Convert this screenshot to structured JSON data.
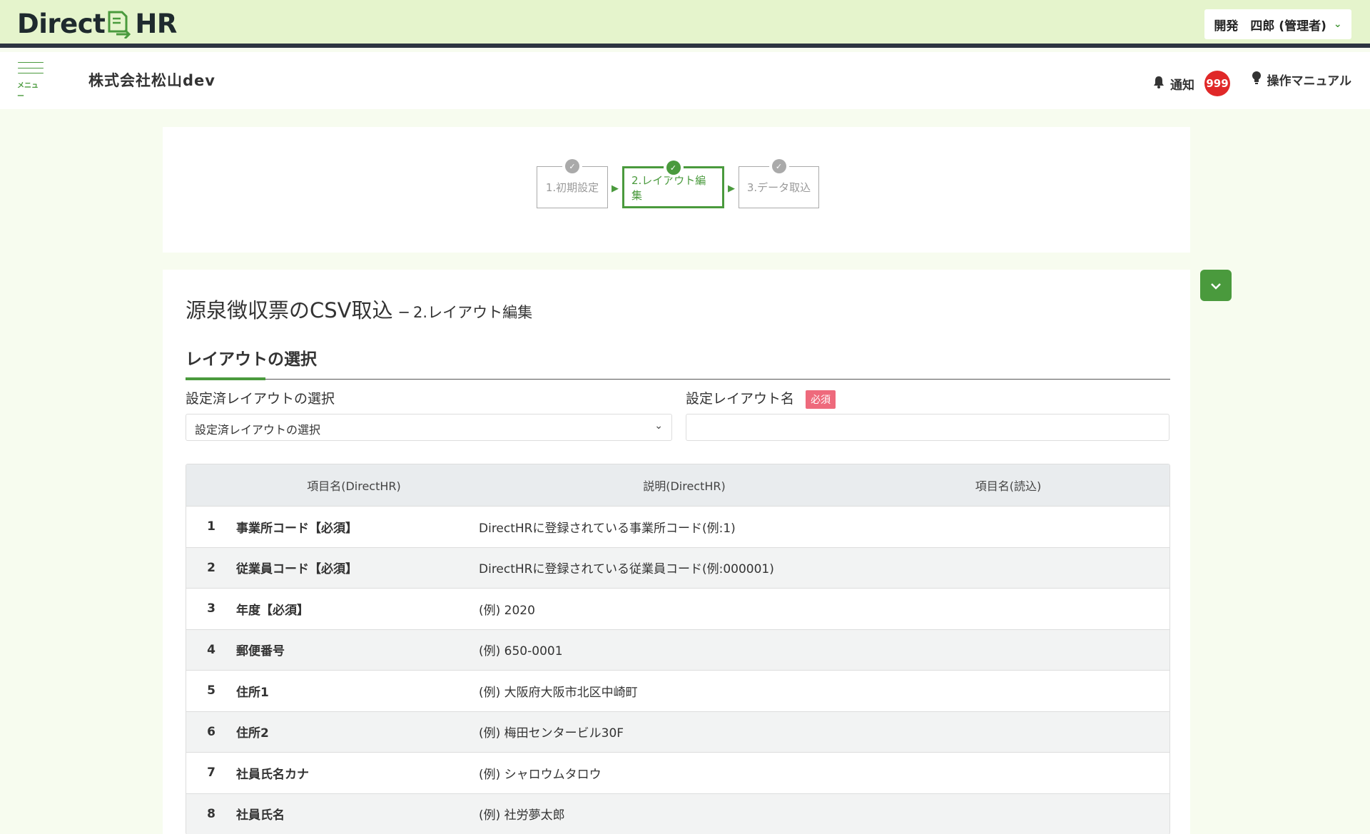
{
  "header": {
    "logo_left": "Direct",
    "logo_right": "HR",
    "user_menu_label": "開発　四郎 (管理者)",
    "brand_color": "#4a9a3d"
  },
  "subheader": {
    "menu_label": "メニュー",
    "company_name": "株式会社松山dev",
    "notification_label": "通知",
    "notification_count": "999",
    "manual_label": "操作マニュアル"
  },
  "steps": [
    {
      "label": "1.初期設定",
      "active": false
    },
    {
      "label": "2.レイアウト編集",
      "active": true
    },
    {
      "label": "3.データ取込",
      "active": false
    }
  ],
  "main": {
    "title": "源泉徴収票のCSV取込",
    "subtitle": "─ 2.レイアウト編集",
    "section_title": "レイアウトの選択",
    "layout_select_label": "設定済レイアウトの選択",
    "layout_select_value": "設定済レイアウトの選択",
    "layout_name_label": "設定レイアウト名",
    "required_badge": "必須",
    "layout_name_value": ""
  },
  "table": {
    "headers": [
      "項目名(DirectHR)",
      "説明(DirectHR)",
      "項目名(読込)"
    ],
    "rows": [
      {
        "num": "1",
        "name": "事業所コード【必須】",
        "desc": "DirectHRに登録されている事業所コード(例:1)",
        "read": ""
      },
      {
        "num": "2",
        "name": "従業員コード【必須】",
        "desc": "DirectHRに登録されている従業員コード(例:000001)",
        "read": ""
      },
      {
        "num": "3",
        "name": "年度【必須】",
        "desc": "(例) 2020",
        "read": ""
      },
      {
        "num": "4",
        "name": "郵便番号",
        "desc": "(例) 650-0001",
        "read": ""
      },
      {
        "num": "5",
        "name": "住所1",
        "desc": "(例) 大阪府大阪市北区中崎町",
        "read": ""
      },
      {
        "num": "6",
        "name": "住所2",
        "desc": "(例) 梅田センタービル30F",
        "read": ""
      },
      {
        "num": "7",
        "name": "社員氏名カナ",
        "desc": "(例) シャロウムタロウ",
        "read": ""
      },
      {
        "num": "8",
        "name": "社員氏名",
        "desc": "(例) 社労夢太郎",
        "read": ""
      }
    ]
  }
}
